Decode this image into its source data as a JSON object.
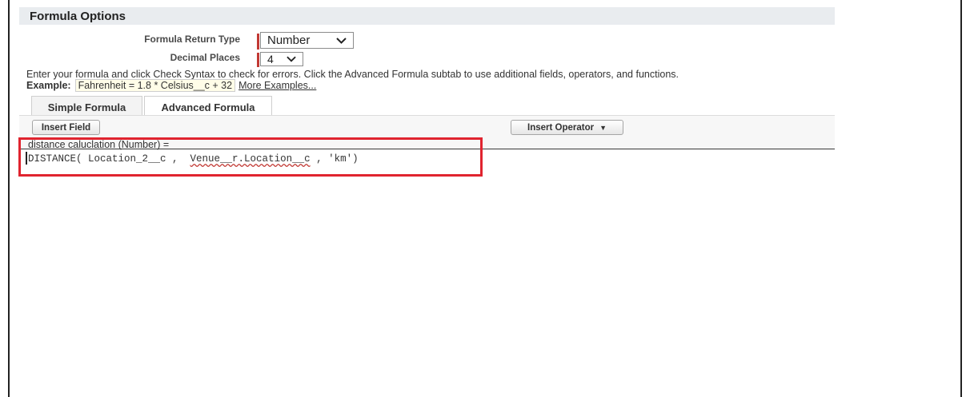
{
  "section": {
    "title": "Formula Options"
  },
  "fields": {
    "return_type": {
      "label": "Formula Return Type",
      "value": "Number"
    },
    "decimal_places": {
      "label": "Decimal Places",
      "value": "4"
    }
  },
  "instructions": "Enter your formula and click Check Syntax to check for errors. Click the Advanced Formula subtab to use additional fields, operators, and functions.",
  "example": {
    "label": "Example:",
    "formula": "Fahrenheit = 1.8 * Celsius__c + 32",
    "more_link": "More Examples..."
  },
  "tabs": [
    {
      "label": "Simple Formula",
      "active": false
    },
    {
      "label": "Advanced Formula",
      "active": true
    }
  ],
  "toolbar": {
    "insert_field": "Insert Field",
    "insert_operator": "Insert Operator",
    "insert_operator_caret": "▼"
  },
  "editor": {
    "label": "distance caluclation (Number) =",
    "code_prefix": "DISTANCE( Location_2__c ,  ",
    "code_flagged": "Venue__r.Location__c",
    "code_suffix": " , 'km')"
  },
  "colors": {
    "required": "#c23934",
    "highlight": "#e0242f"
  }
}
